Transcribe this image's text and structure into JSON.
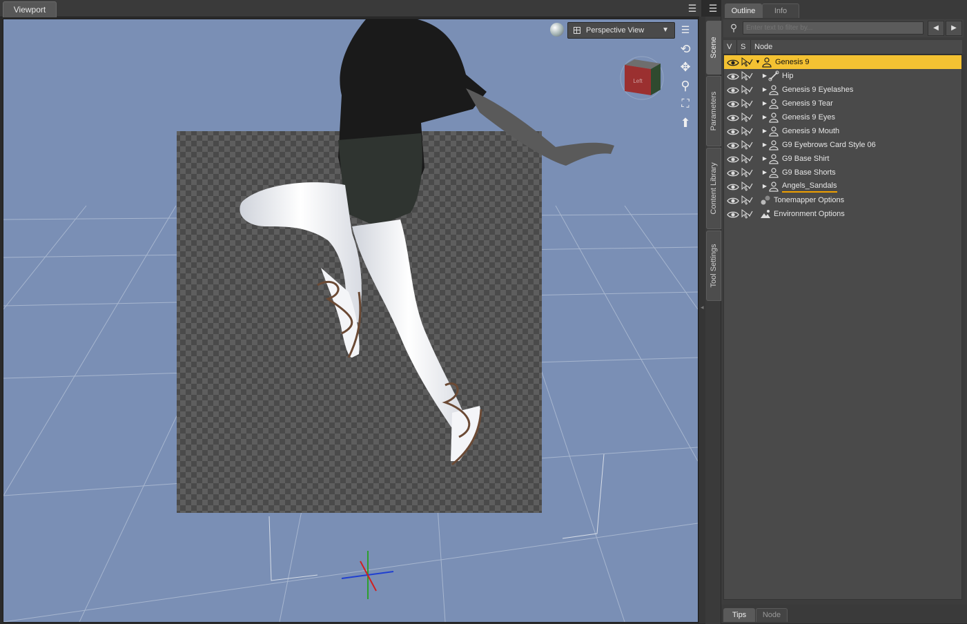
{
  "viewport": {
    "tab_label": "Viewport",
    "view_select": "Perspective View",
    "cube_label": "Left"
  },
  "side_tabs": [
    "Scene",
    "Parameters",
    "Content Library",
    "Tool Settings"
  ],
  "panel": {
    "tabs": [
      "Outline",
      "Info"
    ],
    "filter_placeholder": "Enter text to filter by...",
    "columns": [
      "V",
      "S",
      "Node"
    ],
    "nodes": [
      {
        "label": "Genesis 9",
        "selected": true,
        "expanded": true,
        "icon": "figure-icon",
        "depth": 0
      },
      {
        "label": "Hip",
        "icon": "bone-icon",
        "depth": 1
      },
      {
        "label": "Genesis 9 Eyelashes",
        "icon": "figure-icon",
        "depth": 1
      },
      {
        "label": "Genesis 9 Tear",
        "icon": "figure-icon",
        "depth": 1
      },
      {
        "label": "Genesis 9 Eyes",
        "icon": "figure-icon",
        "depth": 1
      },
      {
        "label": "Genesis 9 Mouth",
        "icon": "figure-icon",
        "depth": 1
      },
      {
        "label": "G9 Eyebrows Card Style 06",
        "icon": "figure-icon",
        "depth": 1
      },
      {
        "label": "G9 Base Shirt",
        "icon": "figure-icon",
        "depth": 1
      },
      {
        "label": "G9 Base Shorts",
        "icon": "figure-icon",
        "depth": 1
      },
      {
        "label": "Angels_Sandals",
        "icon": "figure-icon",
        "depth": 1,
        "underlined": true
      },
      {
        "label": "Tonemapper Options",
        "icon": "tonemapper-icon",
        "depth": 0,
        "leaf": true
      },
      {
        "label": "Environment Options",
        "icon": "environment-icon",
        "depth": 0,
        "leaf": true
      }
    ],
    "bottom_tabs": [
      "Tips",
      "Node"
    ]
  },
  "colors": {
    "viewport_bg": "#7a8fb5",
    "selection": "#f4c232",
    "underline": "#f0a000"
  }
}
